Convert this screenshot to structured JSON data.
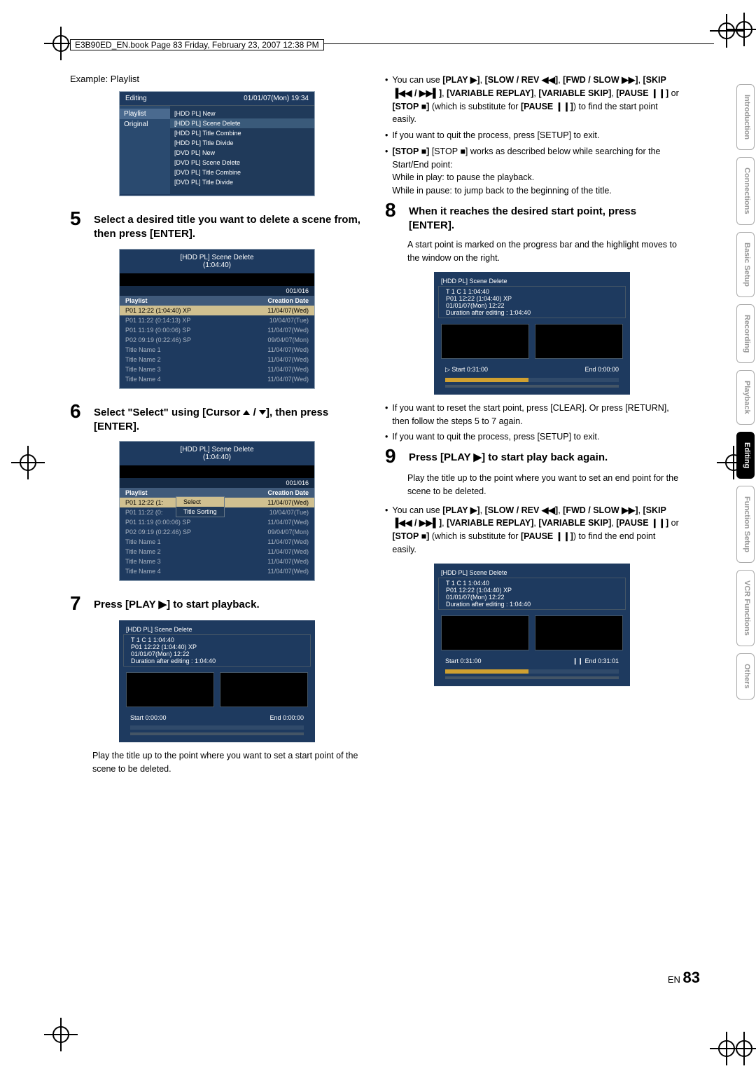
{
  "book_header": "E3B90ED_EN.book  Page 83  Friday, February 23, 2007  12:38 PM",
  "example_label": "Example: Playlist",
  "osd_editing": {
    "header_left": "Editing",
    "header_right": "01/01/07(Mon)    19:34",
    "left_items": [
      "Playlist",
      "Original"
    ],
    "left_selected": 0,
    "right_items": [
      "[HDD PL] New",
      "[HDD PL] Scene Delete",
      "[HDD PL] Title Combine",
      "[HDD PL] Title Divide",
      "[DVD PL] New",
      "[DVD PL] Scene Delete",
      "[DVD PL] Title Combine",
      "[DVD PL] Title Divide"
    ],
    "right_selected": 1
  },
  "step5_label": "5",
  "step5_text": "Select a desired title you want to delete a scene from, then press [ENTER].",
  "osd_scene1": {
    "title": "[HDD PL] Scene Delete",
    "duration": "(1:04:40)",
    "count": "001/016",
    "columns": [
      "Playlist",
      "Creation Date"
    ],
    "rows": [
      {
        "l": "P01   12:22 (1:04:40) XP",
        "r": "11/04/07(Wed)",
        "hl": true
      },
      {
        "l": "P01   11:22 (0:14:13) XP",
        "r": "10/04/07(Tue)"
      },
      {
        "l": "P01   11:19 (0:00:06) SP",
        "r": "11/04/07(Wed)"
      },
      {
        "l": "P02   09:19 (0:22:46) SP",
        "r": "09/04/07(Mon)"
      },
      {
        "l": "Title Name 1",
        "r": "11/04/07(Wed)"
      },
      {
        "l": "Title Name 2",
        "r": "11/04/07(Wed)"
      },
      {
        "l": "Title Name 3",
        "r": "11/04/07(Wed)"
      },
      {
        "l": "Title Name 4",
        "r": "11/04/07(Wed)"
      }
    ]
  },
  "step6_label": "6",
  "step6_text_prefix": "Select \"Select\" using [Cursor ",
  "step6_text_suffix": "], then press [ENTER].",
  "osd_scene2": {
    "title": "[HDD PL] Scene Delete",
    "duration": "(1:04:40)",
    "count": "001/016",
    "columns": [
      "Playlist",
      "Creation Date"
    ],
    "rows": [
      {
        "l": "P01   12:22 (1:",
        "r": "11/04/07(Wed)",
        "popup": true
      },
      {
        "l": "P01   11:22 (0:",
        "r": "10/04/07(Tue)"
      },
      {
        "l": "P01   11:19 (0:00:06) SP",
        "r": "11/04/07(Wed)"
      },
      {
        "l": "P02   09:19 (0:22:46) SP",
        "r": "09/04/07(Mon)"
      },
      {
        "l": "Title Name 1",
        "r": "11/04/07(Wed)"
      },
      {
        "l": "Title Name 2",
        "r": "11/04/07(Wed)"
      },
      {
        "l": "Title Name 3",
        "r": "11/04/07(Wed)"
      },
      {
        "l": "Title Name 4",
        "r": "11/04/07(Wed)"
      }
    ],
    "popup_items": [
      "Select",
      "Title Sorting"
    ],
    "popup_sel": 0
  },
  "step7_label": "7",
  "step7_text": "Press [PLAY ▶] to start playback.",
  "osd_prog1": {
    "title": "[HDD PL] Scene Delete",
    "line1": "T   1  C   1     1:04:40",
    "line2": "P01   12:22 (1:04:40) XP",
    "line3": "01/01/07(Mon)   12:22",
    "line4": "Duration after editing : 1:04:40",
    "start": "Start  0:00:00",
    "end": "End  0:00:00",
    "fill": 0
  },
  "step7_desc": "Play the title up to the point where you want to set a start point of the scene to be deleted.",
  "r_bullet1a": "You can use ",
  "r_bullet1b": " to find the start point easily.",
  "r_tokens": {
    "play": "[PLAY ▶]",
    "slowrev": "[SLOW / REV ◀◀]",
    "fwdslow": "[FWD / SLOW ▶▶]",
    "skip": "[SKIP ▐◀◀ / ▶▶▌]",
    "varrep": "[VARIABLE REPLAY]",
    "varskip": "[VARIABLE SKIP]",
    "pauseII": "[PAUSE ❙❙]",
    "stop": "[STOP ■]",
    "or": " or ",
    "comma": ", ",
    "sub": " (which is substitute for ",
    "close": ")"
  },
  "r_bullet2": "If you want to quit the process, press [SETUP] to exit.",
  "r_bullet3a": "[STOP ■] works as described below while searching for the Start/End point:",
  "r_bullet3b": "While in play: to pause the playback.",
  "r_bullet3c": "While in pause: to jump back to the beginning of the title.",
  "step8_label": "8",
  "step8_text": "When it reaches the desired start point, press [ENTER].",
  "step8_desc": "A start point is marked on the progress bar and the highlight moves to the window on the right.",
  "osd_prog2": {
    "title": "[HDD PL] Scene Delete",
    "line1": "T   1  C   1     1:04:40",
    "line2": "P01   12:22 (1:04:40) XP",
    "line3": "01/01/07(Mon)   12:22",
    "line4": "Duration after editing : 1:04:40",
    "start": "▷  Start  0:31:00",
    "end": "End  0:00:00",
    "fill": 48
  },
  "r_bullet4": "If you want to reset the start point, press [CLEAR]. Or press [RETURN], then follow the steps 5 to 7 again.",
  "r_bullet5": "If you want to quit the process, press [SETUP] to exit.",
  "step9_label": "9",
  "step9_text": "Press [PLAY ▶] to start play back again.",
  "step9_desc": "Play the title up to the point where you want to set an end point for the scene to be deleted.",
  "r_bullet6b": " to find the end point easily.",
  "osd_prog3": {
    "title": "[HDD PL] Scene Delete",
    "line1": "T   1  C   1     1:04:40",
    "line2": "P01   12:22 (1:04:40) XP",
    "line3": "01/01/07(Mon)   12:22",
    "line4": "Duration after editing : 1:04:40",
    "start": "Start  0:31:00",
    "end": "❙❙  End  0:31:01",
    "fill": 48
  },
  "side_tabs": [
    "Introduction",
    "Connections",
    "Basic Setup",
    "Recording",
    "Playback",
    "Editing",
    "Function Setup",
    "VCR Functions",
    "Others"
  ],
  "active_tab": 5,
  "page_num_prefix": "EN",
  "page_num": "83"
}
